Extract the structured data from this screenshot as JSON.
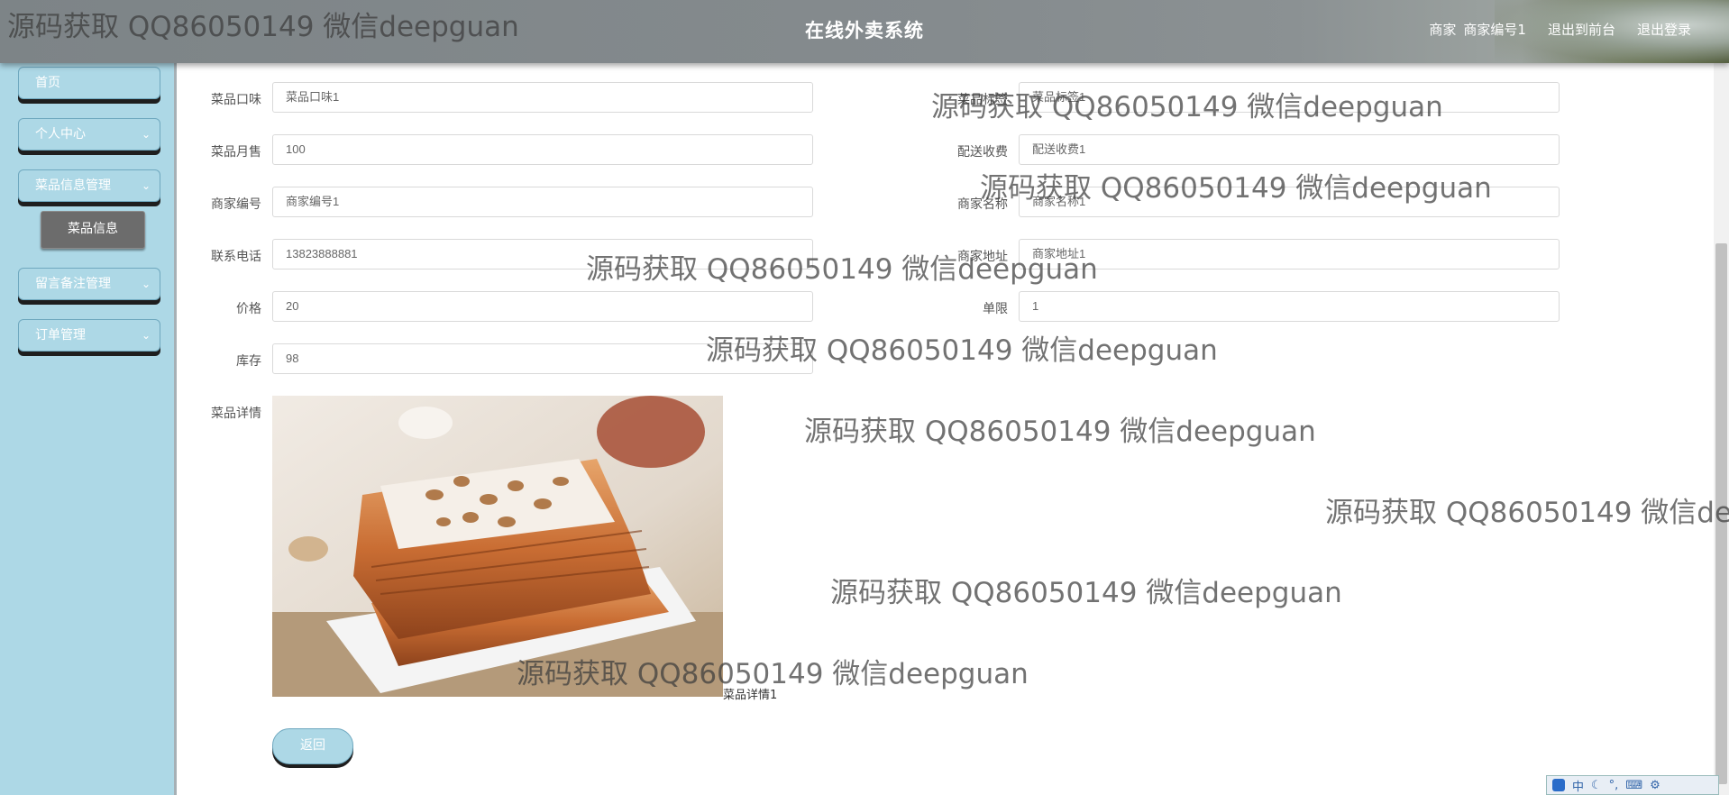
{
  "header": {
    "title": "在线外卖系统",
    "role": "商家",
    "username": "商家编号1",
    "to_front_label": "退出到前台",
    "logout_label": "退出登录"
  },
  "sidebar": {
    "items": [
      {
        "label": "首页"
      },
      {
        "label": "个人中心"
      },
      {
        "label": "菜品信息管理"
      },
      {
        "label": "留言备注管理"
      },
      {
        "label": "订单管理"
      }
    ],
    "active_sub": "菜品信息"
  },
  "form": {
    "taste": {
      "label": "菜品口味",
      "value": "菜品口味1"
    },
    "tag": {
      "label": "菜品标签",
      "value": "菜品标签1"
    },
    "monthly_sales": {
      "label": "菜品月售",
      "value": "100"
    },
    "delivery_fee": {
      "label": "配送收费",
      "value": "配送收费1"
    },
    "merchant_no": {
      "label": "商家编号",
      "value": "商家编号1"
    },
    "merchant_name": {
      "label": "商家名称",
      "value": "商家名称1"
    },
    "phone": {
      "label": "联系电话",
      "value": "13823888881"
    },
    "address": {
      "label": "商家地址",
      "value": "商家地址1"
    },
    "price": {
      "label": "价格",
      "value": "20"
    },
    "limit": {
      "label": "单限",
      "value": "1"
    },
    "stock": {
      "label": "库存",
      "value": "98"
    },
    "detail": {
      "label": "菜品详情",
      "caption": "菜品详情1"
    }
  },
  "back_label": "返回",
  "watermark": "源码获取 QQ86050149 微信deepguan",
  "ime": {
    "label": "中"
  }
}
